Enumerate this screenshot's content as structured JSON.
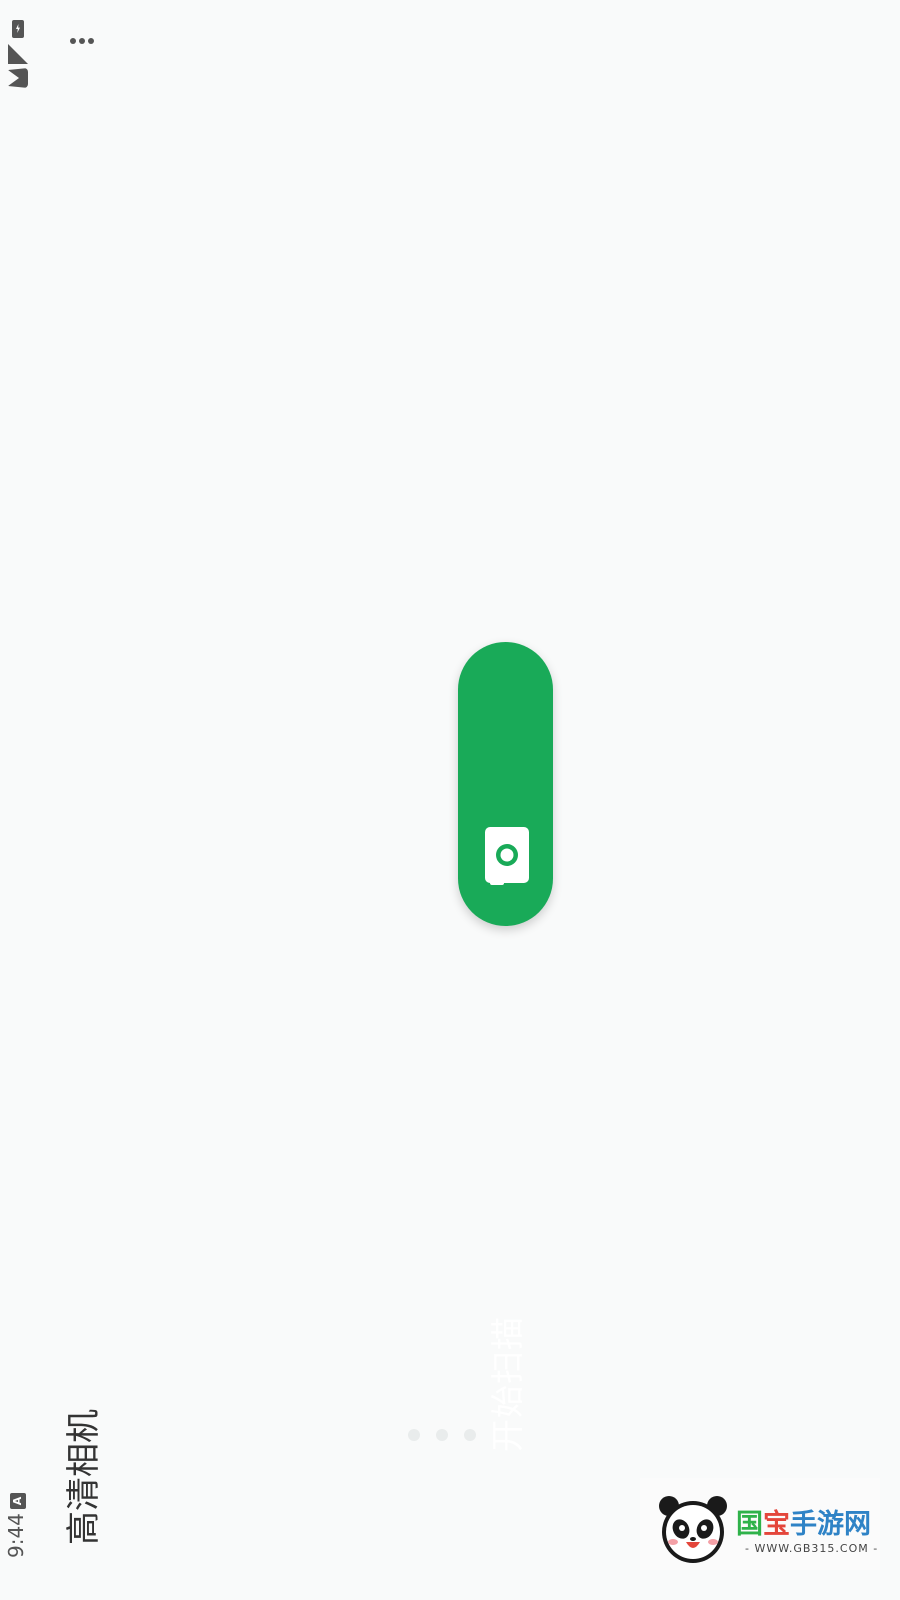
{
  "status_bar": {
    "time": "9:44",
    "notification_icon": "a-letter-icon",
    "icons": [
      "battery-icon",
      "signal-icon",
      "wifi-icon"
    ]
  },
  "header": {
    "app_title": "高清相机",
    "menu_icon": "more-dots-icon"
  },
  "main": {
    "scan_button_label": "开始扫描",
    "scan_button_icon": "camera-icon",
    "accent_color": "#19aa58",
    "page_count": 3
  },
  "watermark": {
    "title_part1": "国",
    "title_part2": "宝",
    "title_part3": "手游网",
    "url": "- WWW.GB315.COM -"
  }
}
